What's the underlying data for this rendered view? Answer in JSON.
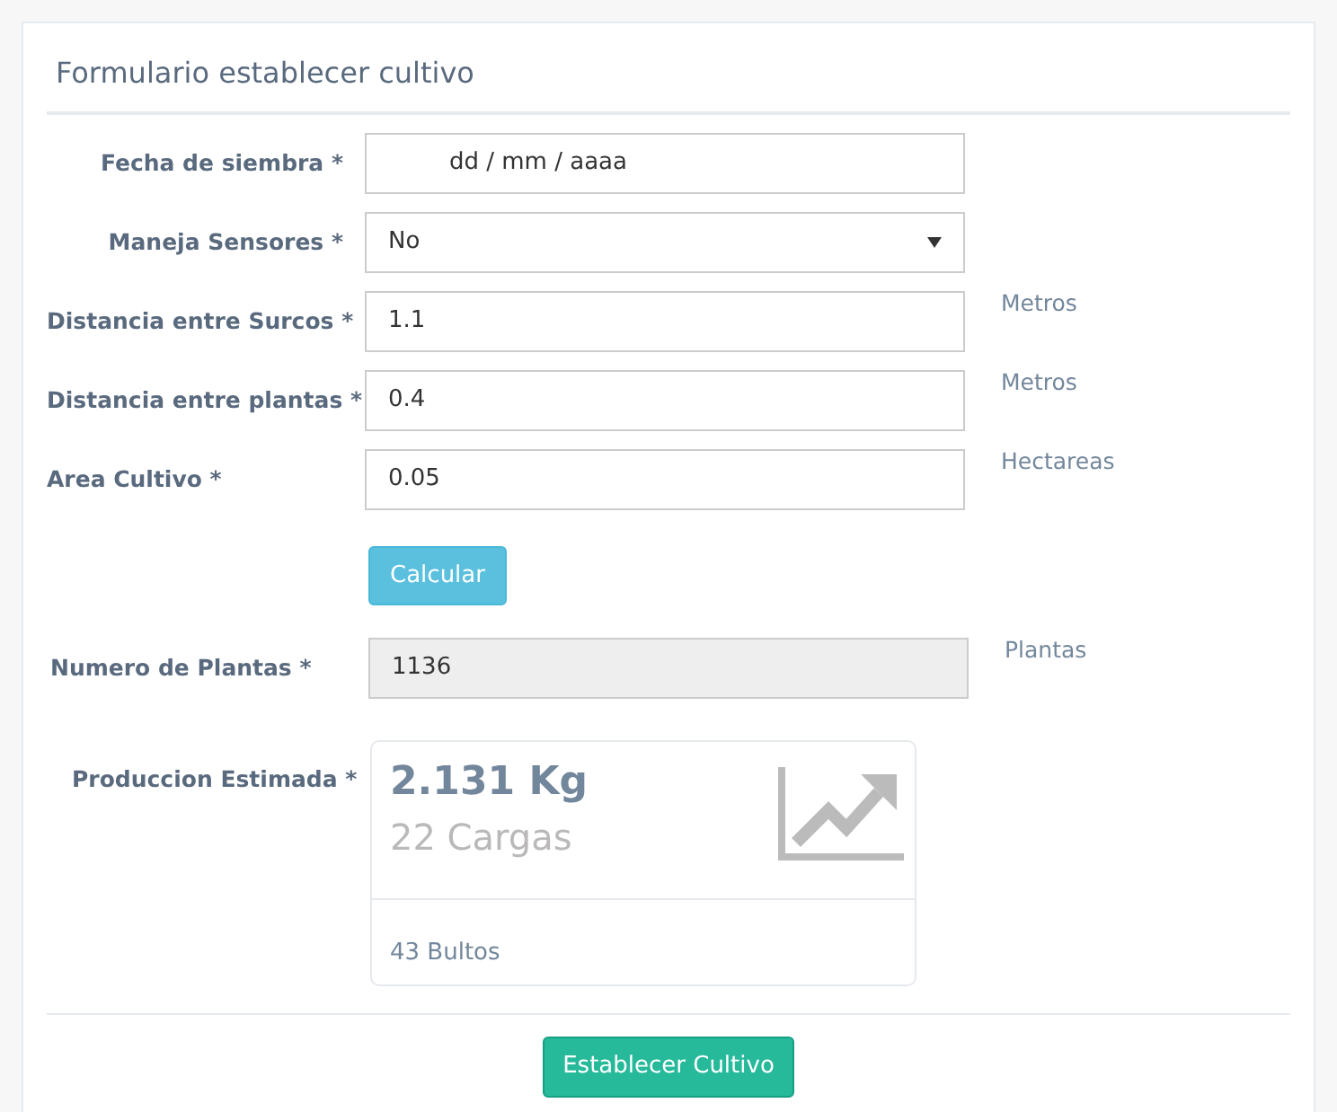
{
  "title": "Formulario establecer cultivo",
  "fields": [
    {
      "kind": "date",
      "label": "Fecha de siembra *",
      "placeholder": "dd / mm / aaaa"
    },
    {
      "kind": "select",
      "label": "Maneja Sensores *",
      "value": "No"
    },
    {
      "kind": "text",
      "label": "Distancia entre Surcos *",
      "value": "1.1",
      "unit": "Metros"
    },
    {
      "kind": "text",
      "label": "Distancia entre plantas *",
      "value": "0.4",
      "unit": "Metros"
    },
    {
      "kind": "text",
      "label": "Area Cultivo *",
      "value": "0.05",
      "unit": "Hectareas"
    }
  ],
  "calculate_button": "Calcular",
  "plants": {
    "label": "Numero de Plantas *",
    "value": "1136",
    "unit": "Plantas",
    "disabled": true
  },
  "production": {
    "label": "Produccion Estimada *",
    "weight": "2.131 Kg",
    "loads": "22 Cargas",
    "bundles": "43 Bultos"
  },
  "submit_button": "Establecer Cultivo"
}
